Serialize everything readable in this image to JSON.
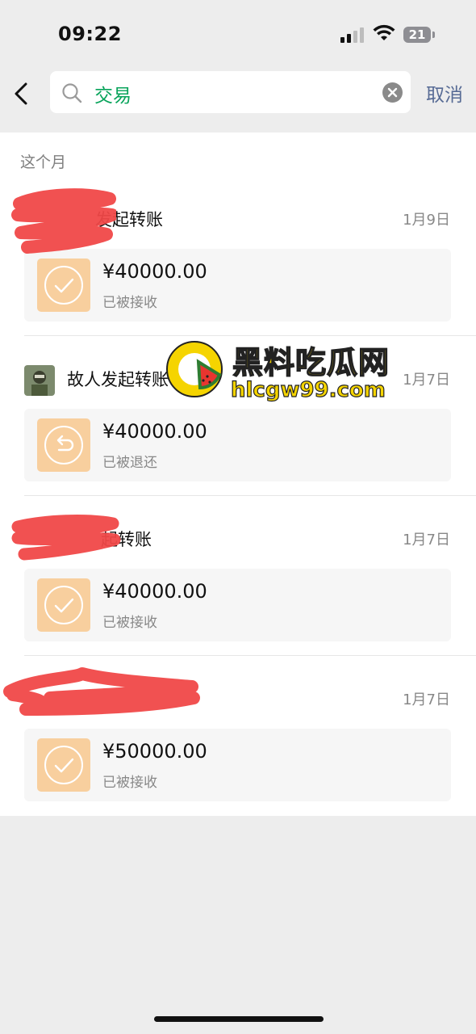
{
  "status_bar": {
    "time": "09:22",
    "battery": "21"
  },
  "search": {
    "query": "交易",
    "cancel_label": "取消"
  },
  "section": {
    "header": "这个月"
  },
  "transactions": [
    {
      "sender": "发起转账",
      "date": "1月9日",
      "amount": "¥40000.00",
      "status": "已被接收",
      "icon": "check-icon"
    },
    {
      "sender": "故人发起转账",
      "date": "1月7日",
      "amount": "¥40000.00",
      "status": "已被退还",
      "icon": "return-icon"
    },
    {
      "sender": "起转账",
      "date": "1月7日",
      "amount": "¥40000.00",
      "status": "已被接收",
      "icon": "check-icon"
    },
    {
      "sender": "",
      "date": "1月7日",
      "amount": "¥50000.00",
      "status": "已被接收",
      "icon": "check-icon"
    }
  ],
  "watermark": {
    "name": "黑料吃瓜网",
    "url": "hlcgw99.com"
  },
  "colors": {
    "accent_green": "#07a35a",
    "link_blue": "#576b95",
    "transfer_orange": "#f8cf9e",
    "redaction": "#f04848"
  }
}
